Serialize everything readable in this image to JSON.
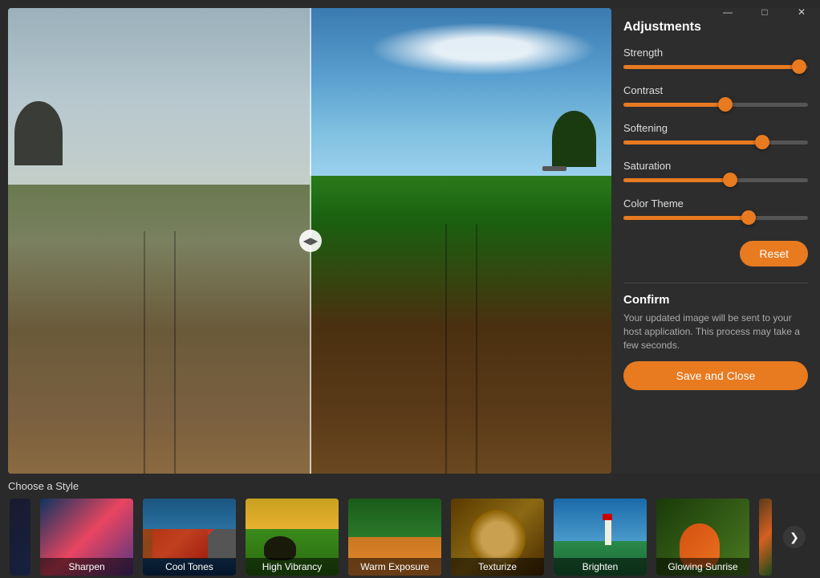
{
  "titlebar": {
    "minimize_label": "—",
    "maximize_label": "□",
    "close_label": "✕"
  },
  "adjustments": {
    "title": "Adjustments",
    "sliders": [
      {
        "id": "strength",
        "label": "Strength",
        "value": 95,
        "percent": 95
      },
      {
        "id": "contrast",
        "label": "Contrast",
        "value": 55,
        "percent": 55
      },
      {
        "id": "softening",
        "label": "Softening",
        "value": 75,
        "percent": 75
      },
      {
        "id": "saturation",
        "label": "Saturation",
        "value": 58,
        "percent": 58
      },
      {
        "id": "color_theme",
        "label": "Color Theme",
        "value": 68,
        "percent": 68
      }
    ],
    "reset_label": "Reset"
  },
  "confirm": {
    "title": "Confirm",
    "description": "Your updated image will be sent to your host application. This process may take a few seconds.",
    "save_label": "Save and Close"
  },
  "bottom": {
    "section_title": "Choose a Style",
    "styles": [
      {
        "id": "first",
        "label": "",
        "thumb_class": "thumb-first"
      },
      {
        "id": "sharpen",
        "label": "Sharpen",
        "thumb_class": "thumb-sharpen"
      },
      {
        "id": "cool_tones",
        "label": "Cool Tones",
        "thumb_class": "thumb-cool"
      },
      {
        "id": "high_vibrancy",
        "label": "High Vibrancy",
        "thumb_class": "thumb-high"
      },
      {
        "id": "warm_exposure",
        "label": "Warm Exposure",
        "thumb_class": "thumb-warm"
      },
      {
        "id": "texturize",
        "label": "Texturize",
        "thumb_class": "thumb-texturize"
      },
      {
        "id": "brighten",
        "label": "Brighten",
        "thumb_class": "thumb-brighten"
      },
      {
        "id": "glowing_sunrise",
        "label": "Glowing Sunrise",
        "thumb_class": "thumb-glowing"
      },
      {
        "id": "next",
        "label": "",
        "thumb_class": "thumb-next"
      }
    ],
    "next_arrow": "❯"
  }
}
